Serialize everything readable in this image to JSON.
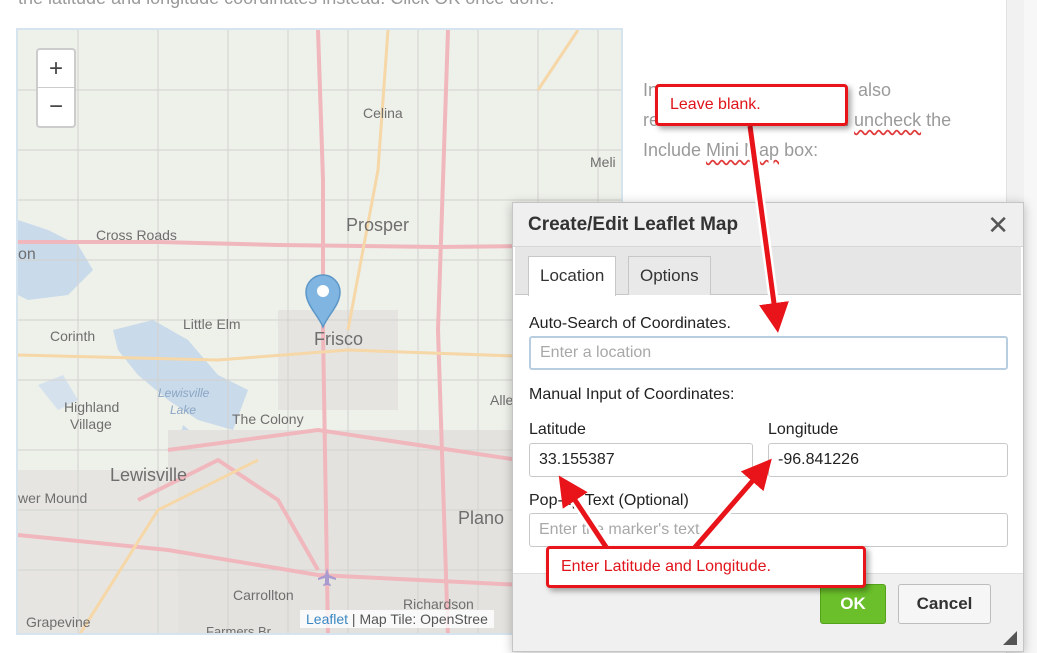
{
  "top_text": "the latitude and longitude coordinates instead. Click OK once done.",
  "paragraph": {
    "line1": "In",
    "line1b": "also",
    "line2": "re",
    "line2b": "u",
    "uncheck": "uncheck",
    "line2c": "the",
    "line3a": "Include ",
    "minimap": "Mini Map",
    "line3b": " box:"
  },
  "map": {
    "zoom_in": "+",
    "zoom_out": "−",
    "labels": {
      "celina": "Celina",
      "melissa": "Meli",
      "prosper": "Prosper",
      "cross_roads": "Cross Roads",
      "on": "on",
      "little_elm": "Little Elm",
      "frisco": "Frisco",
      "corinth": "Corinth",
      "lewisville_lake": "Lewisville",
      "lake": "Lake",
      "highland": "Highland",
      "village": "Village",
      "the_colony": "The Colony",
      "allen": "Alle",
      "lewisville": "Lewisville",
      "flower_mound": "wer Mound",
      "plano": "Plano",
      "carrollton": "Carrollton",
      "richardson": "Richardson",
      "grapevine": "Grapevine",
      "farmers_branch": "Farmers Br"
    },
    "attribution_link": "Leaflet",
    "attribution_text": " | Map Tile: OpenStree"
  },
  "dialog": {
    "title": "Create/Edit Leaflet Map",
    "close": "✕",
    "tabs": [
      "Location",
      "Options"
    ],
    "auto_search_label": "Auto-Search of Coordinates.",
    "auto_search_placeholder": "Enter a location",
    "manual_label": "Manual Input of Coordinates:",
    "latitude_label": "Latitude",
    "latitude_value": "33.155387",
    "longitude_label": "Longitude",
    "longitude_value": "-96.841226",
    "popup_label": "Pop-up Text (Optional)",
    "popup_placeholder": "Enter the marker's text.",
    "ok": "OK",
    "cancel": "Cancel"
  },
  "callouts": {
    "leave_blank": "Leave blank.",
    "enter_latlon": "Enter Latitude and Longitude."
  },
  "colors": {
    "callout_red": "#e8141a",
    "ok_green": "#6bbf2a",
    "marker_blue": "#7fb5e0"
  }
}
